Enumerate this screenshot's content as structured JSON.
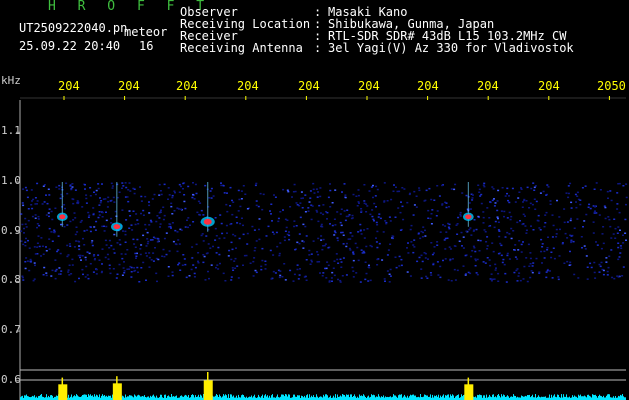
{
  "header": {
    "app_title": "H R O F F T",
    "file_name": "UT2509222040.pn",
    "mode": "meteor",
    "date_time": "25.09.22 20:40",
    "count": "16",
    "fields": [
      {
        "label": "Observer",
        "value": "Masaki Kano"
      },
      {
        "label": "Receiving Location",
        "value": "Shibukawa, Gunma, Japan"
      },
      {
        "label": "Receiver",
        "value": "RTL-SDR SDR# 43dB L15 103.2MHz CW"
      },
      {
        "label": "Receiving Antenna",
        "value": "3el Yagi(V) Az 330 for Vladivostok"
      }
    ],
    "separator": ":"
  },
  "axes": {
    "y_unit": "kHz",
    "y_ticks": [
      "1.1",
      "1.0",
      "0.9",
      "0.8",
      "0.7",
      "0.6"
    ],
    "x_ticks": [
      "204",
      "204",
      "204",
      "204",
      "204",
      "204",
      "204",
      "204",
      "204",
      "2050"
    ]
  },
  "chart_data": {
    "type": "heatmap",
    "description_free": true,
    "y_axis": {
      "unit": "kHz",
      "ticks": [
        1.1,
        1.0,
        0.9,
        0.8,
        0.7,
        0.6
      ]
    },
    "noise_band_khz": [
      0.8,
      1.0
    ],
    "meteor_echoes": [
      {
        "t_col": 0.5,
        "freq_khz": 0.93,
        "strength": 0.6
      },
      {
        "t_col": 1.4,
        "freq_khz": 0.91,
        "strength": 0.7
      },
      {
        "t_col": 2.9,
        "freq_khz": 0.92,
        "strength": 1.0
      },
      {
        "t_col": 7.2,
        "freq_khz": 0.93,
        "strength": 0.6
      }
    ],
    "colors": {
      "background": "#000000",
      "noise": "#1a2cc8",
      "tick": "#ffff00",
      "strength_bar": "#00e5ff",
      "peak": "#ffee00"
    }
  }
}
